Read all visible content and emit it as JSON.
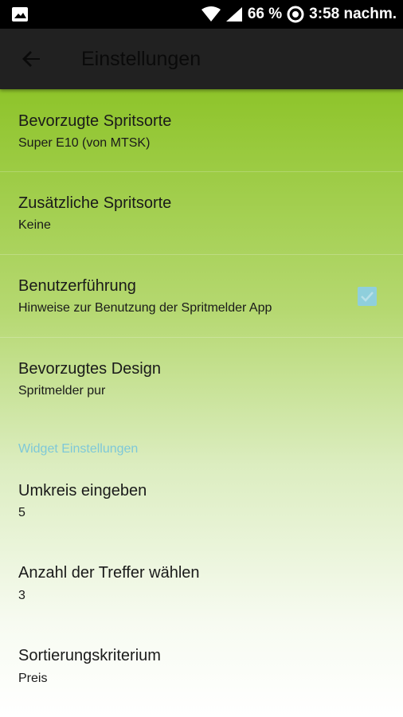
{
  "status_bar": {
    "battery": "66 %",
    "time": "3:58 nachm.",
    "icons": [
      "image-icon",
      "wifi-icon",
      "signal-icon",
      "sync-icon"
    ]
  },
  "toolbar": {
    "title": "Einstellungen",
    "back_icon": "arrow-back-icon"
  },
  "preferences": [
    {
      "title": "Bevorzugte Spritsorte",
      "summary": "Super E10 (von MTSK)"
    },
    {
      "title": "Zusätzliche Spritsorte",
      "summary": "Keine"
    },
    {
      "title": "Benutzerführung",
      "summary": "Hinweise zur Benutzung der Spritmelder App",
      "checked": true
    },
    {
      "title": "Bevorzugtes Design",
      "summary": "Spritmelder pur"
    }
  ],
  "widget_category": "Widget Einstellungen",
  "widget_preferences": [
    {
      "title": "Umkreis eingeben",
      "summary": "5"
    },
    {
      "title": "Anzahl der Treffer wählen",
      "summary": "3"
    },
    {
      "title": "Sortierungskriterium",
      "summary": "Preis"
    }
  ],
  "colors": {
    "accent": "#8fcfdc",
    "toolbar": "#212121",
    "gradient_top": "#8ec42a"
  }
}
